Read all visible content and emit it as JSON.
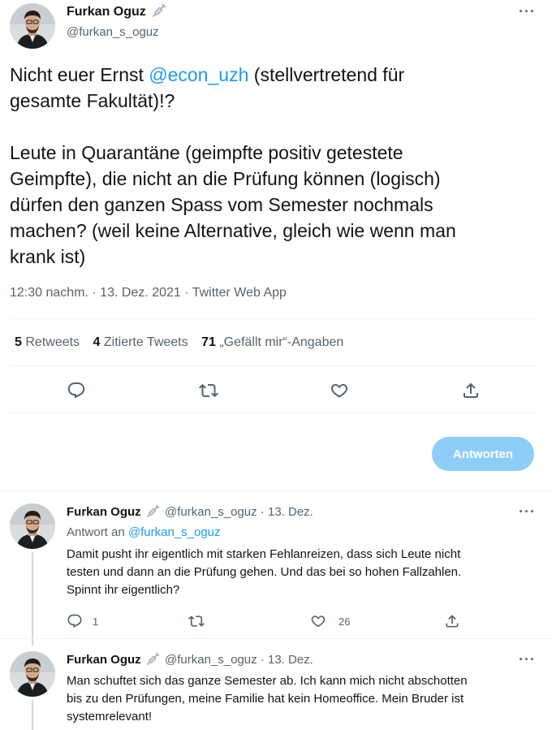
{
  "main_tweet": {
    "author_name": "Furkan Oguz",
    "author_handle": "@furkan_s_oguz",
    "text_line1_before": "Nicht euer Ernst ",
    "text_mention": "@econ_uzh",
    "text_line1_after": " (stellvertretend für",
    "text_line2": "gesamte Fakultät)!?",
    "para2_lines": [
      "Leute in Quarantäne (geimpfte positiv getestete",
      "Geimpfte), die nicht an die Prüfung können (logisch)",
      "dürfen den ganzen Spass vom Semester nochmals",
      "machen? (weil keine Alternative, gleich wie wenn man",
      "krank ist)"
    ],
    "meta": "12:30 nachm. · 13. Dez. 2021 · Twitter Web App",
    "stats": {
      "retweets_count": "5",
      "retweets_label": "Retweets",
      "quotes_count": "4",
      "quotes_label": "Zitierte Tweets",
      "likes_count": "71",
      "likes_label": "„Gefällt mir“-Angaben"
    },
    "reply_button": "Antworten"
  },
  "replies": [
    {
      "author_name": "Furkan Oguz",
      "author_handle": "@furkan_s_oguz",
      "date": "· 13. Dez.",
      "reply_to_label": "Antwort an",
      "reply_to_handle": "@furkan_s_oguz",
      "lines": [
        "Damit pusht ihr eigentlich mit starken Fehlanreizen, dass sich Leute nicht",
        "testen und dann an die Prüfung gehen. Und das bei so hohen Fallzahlen.",
        "Spinnt ihr eigentlich?"
      ],
      "reply_count": "1",
      "retweet_count": "",
      "like_count": "26"
    },
    {
      "author_name": "Furkan Oguz",
      "author_handle": "@furkan_s_oguz",
      "date": "· 13. Dez.",
      "lines": [
        "Man schuftet sich das ganze Semester ab. Ich kann mich nicht abschotten",
        "bis zu den Prüfungen, meine Familie hat kein Homeoffice. Mein Bruder ist",
        "systemrelevant!"
      ]
    }
  ],
  "icons": {
    "more": "more-icon",
    "reply": "reply-icon",
    "retweet": "retweet-icon",
    "like": "like-icon",
    "share": "share-icon",
    "badge": "syringe-icon"
  },
  "colors": {
    "accent": "#1d9bf0",
    "reply_button_bg": "#8ecdf8",
    "muted_text": "#536471",
    "divider": "#eff3f4"
  }
}
